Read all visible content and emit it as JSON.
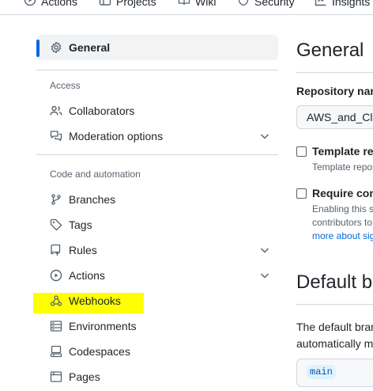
{
  "topnav": {
    "tabs": [
      {
        "label": "Actions",
        "icon": "play-icon"
      },
      {
        "label": "Projects",
        "icon": "table-icon"
      },
      {
        "label": "Wiki",
        "icon": "book-icon"
      },
      {
        "label": "Security",
        "icon": "shield-icon"
      },
      {
        "label": "Insights",
        "icon": "graph-icon"
      }
    ]
  },
  "sidebar": {
    "general": {
      "label": "General",
      "icon": "gear-icon"
    },
    "access_heading": "Access",
    "access_items": [
      {
        "label": "Collaborators",
        "icon": "people-icon",
        "expandable": false
      },
      {
        "label": "Moderation options",
        "icon": "comment-discussion-icon",
        "expandable": true
      }
    ],
    "code_heading": "Code and automation",
    "code_items": [
      {
        "label": "Branches",
        "icon": "git-branch-icon",
        "expandable": false
      },
      {
        "label": "Tags",
        "icon": "tag-icon",
        "expandable": false
      },
      {
        "label": "Rules",
        "icon": "repo-push-icon",
        "expandable": true
      },
      {
        "label": "Actions",
        "icon": "play-icon",
        "expandable": true
      },
      {
        "label": "Webhooks",
        "icon": "webhook-icon",
        "expandable": false,
        "highlighted": true
      },
      {
        "label": "Environments",
        "icon": "server-icon",
        "expandable": false
      },
      {
        "label": "Codespaces",
        "icon": "codespaces-icon",
        "expandable": false
      },
      {
        "label": "Pages",
        "icon": "browser-icon",
        "expandable": false
      }
    ]
  },
  "main": {
    "title": "General",
    "repo_name_label": "Repository nam",
    "repo_name_value": "AWS_and_Clo",
    "template": {
      "title": "Template rep",
      "desc": "Template repos"
    },
    "require": {
      "title": "Require cont",
      "desc_line1": "Enabling this s",
      "desc_line2": "contributors to",
      "link": "more about sig"
    },
    "default_branch_title": "Default b",
    "default_branch_desc_line1": "The default bran",
    "default_branch_desc_line2": "automatically m",
    "default_branch_value": "main"
  },
  "colors": {
    "accent": "#0969da",
    "highlight": "#ffff00",
    "active_bg": "#f1f3f5",
    "muted_text": "#59636e",
    "border": "#d0d7de"
  }
}
